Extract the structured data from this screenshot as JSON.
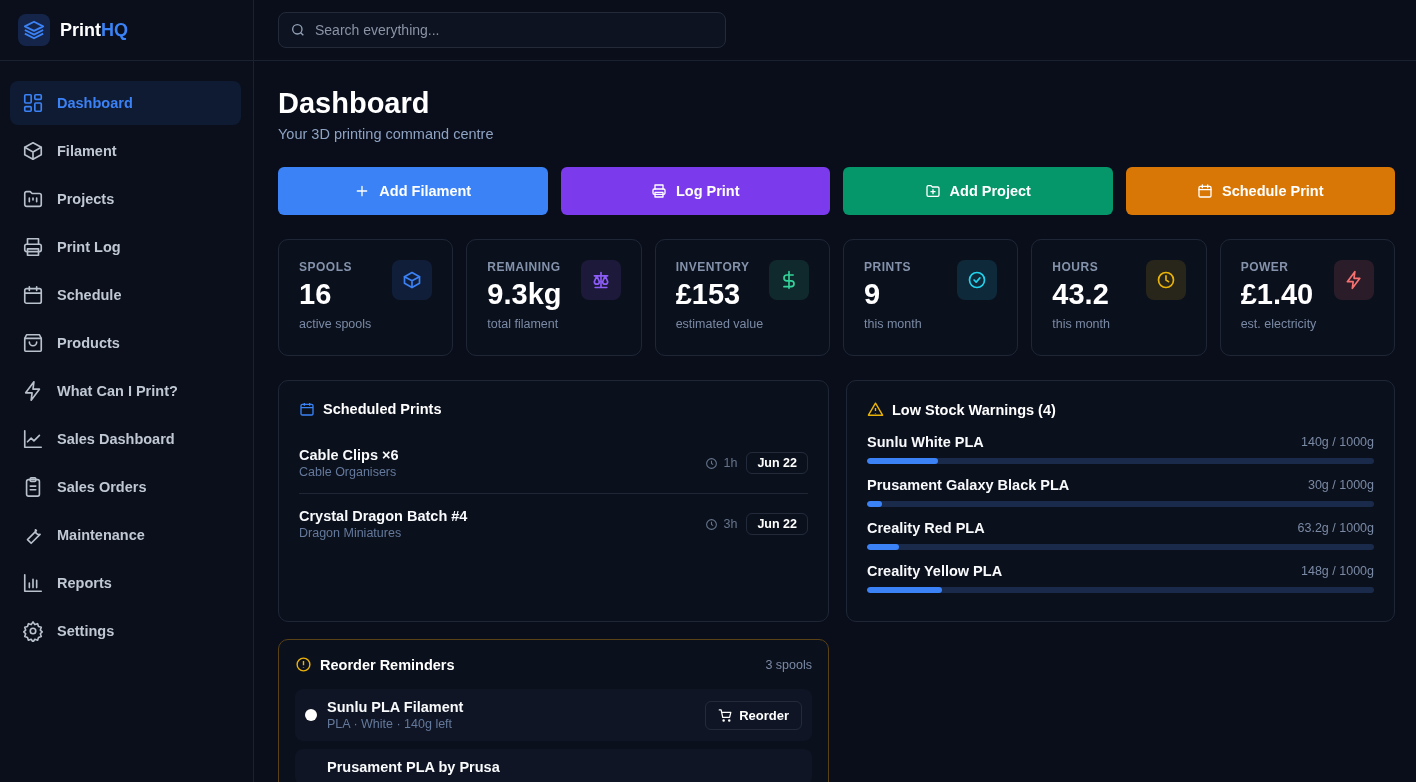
{
  "brand": {
    "name": "Print",
    "accent": "HQ"
  },
  "search": {
    "placeholder": "Search everything..."
  },
  "nav": [
    {
      "label": "Dashboard",
      "selected": true
    },
    {
      "label": "Filament",
      "selected": false
    },
    {
      "label": "Projects",
      "selected": false
    },
    {
      "label": "Print Log",
      "selected": false
    },
    {
      "label": "Schedule",
      "selected": false
    },
    {
      "label": "Products",
      "selected": false
    },
    {
      "label": "What Can I Print?",
      "selected": false
    },
    {
      "label": "Sales Dashboard",
      "selected": false
    },
    {
      "label": "Sales Orders",
      "selected": false
    },
    {
      "label": "Maintenance",
      "selected": false
    },
    {
      "label": "Reports",
      "selected": false
    },
    {
      "label": "Settings",
      "selected": false
    }
  ],
  "page": {
    "title": "Dashboard",
    "subtitle": "Your 3D printing command centre"
  },
  "actions": [
    {
      "label": "Add Filament",
      "color": "#3b82f6"
    },
    {
      "label": "Log Print",
      "color": "#7c3aed"
    },
    {
      "label": "Add Project",
      "color": "#059669"
    },
    {
      "label": "Schedule Print",
      "color": "#d97706"
    }
  ],
  "stats": [
    {
      "label": "SPOOLS",
      "value": "16",
      "caption": "active spools",
      "color": "#3b82f6"
    },
    {
      "label": "REMAINING",
      "value": "9.3kg",
      "caption": "total filament",
      "color": "#8b5cf6"
    },
    {
      "label": "INVENTORY",
      "value": "£153",
      "caption": "estimated value",
      "color": "#34d399"
    },
    {
      "label": "PRINTS",
      "value": "9",
      "caption": "this month",
      "color": "#22d3ee"
    },
    {
      "label": "HOURS",
      "value": "43.2",
      "caption": "this month",
      "color": "#eab308"
    },
    {
      "label": "POWER",
      "value": "£1.40",
      "caption": "est. electricity",
      "color": "#f87171"
    }
  ],
  "scheduled": {
    "title": "Scheduled Prints",
    "items": [
      {
        "name": "Cable Clips ×6",
        "project": "Cable Organisers",
        "duration": "1h",
        "date": "Jun 22"
      },
      {
        "name": "Crystal Dragon Batch #4",
        "project": "Dragon Miniatures",
        "duration": "3h",
        "date": "Jun 22"
      }
    ]
  },
  "low_stock": {
    "title": "Low Stock Warnings (4)",
    "items": [
      {
        "name": "Sunlu White PLA",
        "amount": "140g / 1000g",
        "level": 0.14
      },
      {
        "name": "Prusament Galaxy Black PLA",
        "amount": "30g / 1000g",
        "level": 0.03
      },
      {
        "name": "Creality Red PLA",
        "amount": "63.2g / 1000g",
        "level": 0.0632
      },
      {
        "name": "Creality Yellow PLA",
        "amount": "148g / 1000g",
        "level": 0.148
      }
    ]
  },
  "reorder": {
    "title": "Reorder Reminders",
    "count": "3 spools",
    "items": [
      {
        "name": "Sunlu PLA Filament",
        "details": "PLA · White · 140g left",
        "color": "#ffffff",
        "button": "Reorder"
      },
      {
        "name": "Prusament PLA by Prusa"
      }
    ]
  }
}
